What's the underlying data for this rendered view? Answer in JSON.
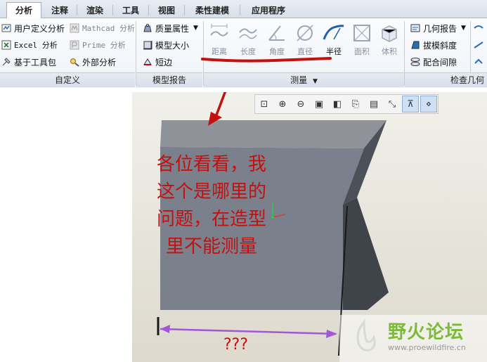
{
  "tabs": [
    {
      "label": "分析",
      "active": true
    },
    {
      "label": "注释"
    },
    {
      "label": "渲染"
    },
    {
      "label": "工具"
    },
    {
      "label": "视图"
    },
    {
      "label": "柔性建模"
    },
    {
      "label": "应用程序"
    }
  ],
  "custom_group": {
    "label": "自定义",
    "items": [
      "用户定义分析",
      "Mathcad 分析",
      "Excel 分析",
      "Prime 分析",
      "基于工具包",
      "外部分析"
    ]
  },
  "model_report_group": {
    "label": "模型报告",
    "items": [
      "质量属性",
      "模型大小",
      "短边"
    ]
  },
  "measure_group": {
    "label": "测量",
    "buttons": [
      "距离",
      "长度",
      "角度",
      "直径",
      "半径",
      "面积",
      "体积"
    ]
  },
  "check_group": {
    "label": "检查几何",
    "items": [
      "几何报告",
      "拔模斜度",
      "配合间隙"
    ]
  },
  "annotation": {
    "question_lines": [
      "各位看看，我",
      "这个是哪里的",
      "问题，在造型",
      "里不能测量"
    ],
    "dimension_text": "???"
  },
  "watermark": {
    "title": "野火论坛",
    "url": "www.proewildfire.cn"
  },
  "colors": {
    "annotation_red": "#c4100e",
    "dimension_purple": "#a357d6",
    "viewport_bg": "#e8e6de",
    "model_face": "#7b818c"
  }
}
